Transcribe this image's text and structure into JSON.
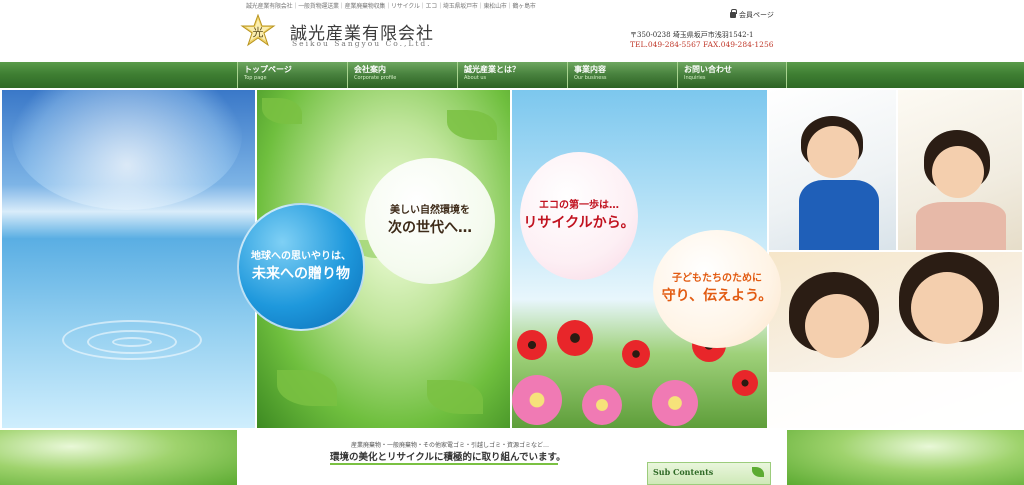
{
  "header": {
    "seo_text": "誠光産業有限会社｜一般貨物運送業｜産業廃棄物収集｜リサイクル｜エコ｜埼玉県坂戸市｜東松山市｜鶴ヶ島市",
    "logo_glyph": "光",
    "company_name": "誠光産業有限会社",
    "company_romaji": "Seikou Sangyou Co.,Ltd.",
    "member_link": "会員ページ",
    "address": "〒350-0238 埼玉県坂戸市浅羽1542-1",
    "tel_fax": "TEL.049-284-5567 FAX.049-284-1256"
  },
  "nav": {
    "items": [
      {
        "jp": "トップページ",
        "en": "Top page"
      },
      {
        "jp": "会社案内",
        "en": "Corporate profile"
      },
      {
        "jp": "誠光産業とは？",
        "en": "About us"
      },
      {
        "jp": "事業内容",
        "en": "Our business"
      },
      {
        "jp": "お問い合わせ",
        "en": "Inquiries"
      }
    ]
  },
  "hero": {
    "bubble_earth": {
      "line1": "地球への思いやりは、",
      "line2": "未来への贈り物"
    },
    "bubble_nature": {
      "line1": "美しい自然環境を",
      "line2": "次の世代へ…"
    },
    "bubble_eco": {
      "line1": "エコの第一歩は…",
      "line2": "リサイクルから。"
    },
    "bubble_kids": {
      "line1": "子どもたちのために",
      "line2": "守り、伝えよう。"
    }
  },
  "intro": {
    "small": "産業廃棄物・一般廃棄物・その他家電ゴミ・引越しゴミ・資源ゴミなど…",
    "big": "環境の美化とリサイクルに積極的に取り組んでいます。"
  },
  "sidebar": {
    "sub_contents_title": "Sub Contents"
  },
  "colors": {
    "nav_green": "#3f7f33",
    "tel_red": "#c0392b",
    "eco_red": "#c1121f",
    "kids_orange": "#e25b12",
    "bubble_blue": "#1e98dc"
  }
}
